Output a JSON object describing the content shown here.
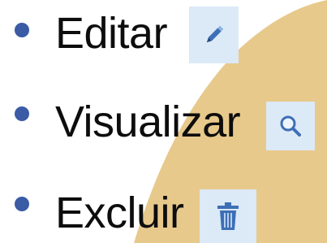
{
  "colors": {
    "background": "#ffffff",
    "decorative_shape": "#e8c98c",
    "bullet": "#3b5ba5",
    "icon_background": "#dce9f7",
    "icon_primary": "#3d6fb6",
    "text": "#0d0d0d"
  },
  "items": [
    {
      "label": "Editar",
      "icon": "pencil-icon"
    },
    {
      "label": "Visualizar",
      "icon": "magnifier-icon"
    },
    {
      "label": "Excluir",
      "icon": "trash-icon"
    }
  ]
}
